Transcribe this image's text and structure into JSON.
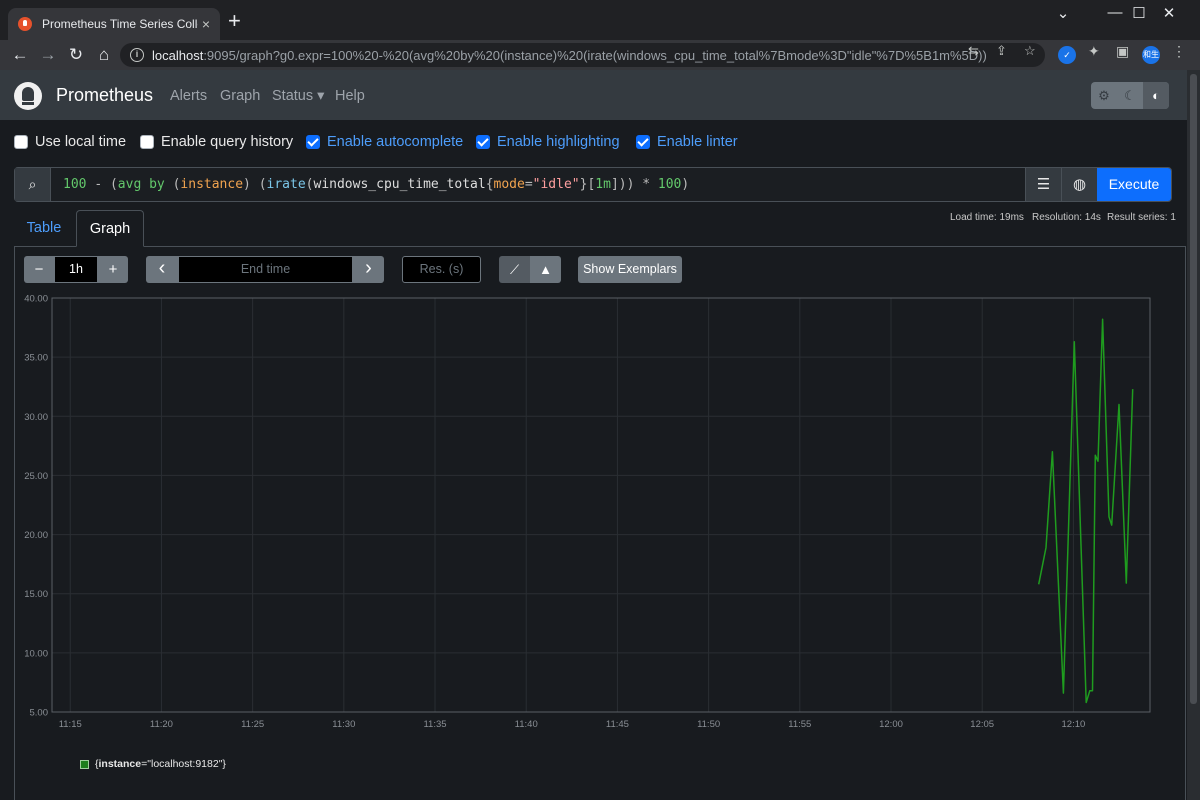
{
  "browser": {
    "tab_title": "Prometheus Time Series Collectio",
    "close_glyph": "×",
    "new_tab_glyph": "+",
    "url_host": "localhost",
    "url_rest": ":9095/graph?g0.expr=100%20-%20(avg%20by%20(instance)%20(irate(windows_cpu_time_total%7Bmode%3D\"idle\"%7D%5B1m%5D))%2...",
    "profile_label": "和生"
  },
  "nav": {
    "brand": "Prometheus",
    "links": [
      "Alerts",
      "Graph",
      "Status ▾",
      "Help"
    ]
  },
  "options": [
    {
      "label": "Use local time",
      "checked": false
    },
    {
      "label": "Enable query history",
      "checked": false
    },
    {
      "label": "Enable autocomplete",
      "checked": true
    },
    {
      "label": "Enable highlighting",
      "checked": true
    },
    {
      "label": "Enable linter",
      "checked": true
    }
  ],
  "query": {
    "expression": "100 - (avg by (instance) (irate(windows_cpu_time_total{mode=\"idle\"}[1m])) * 100)",
    "execute_label": "Execute"
  },
  "stats": {
    "load_time": "Load time: 19ms",
    "resolution": "Resolution: 14s",
    "result_series": "Result series: 1"
  },
  "tabs": {
    "table": "Table",
    "graph": "Graph"
  },
  "graph_controls": {
    "minus": "−",
    "range": "1h",
    "plus": "+",
    "prev": "‹",
    "end_time_placeholder": "End time",
    "next": "›",
    "resolution_placeholder": "Res. (s)",
    "show_exemplars": "Show Exemplars"
  },
  "chart_data": {
    "type": "line",
    "x_ticks": [
      "11:15",
      "11:20",
      "11:25",
      "11:30",
      "11:35",
      "11:40",
      "11:45",
      "11:50",
      "11:55",
      "12:00",
      "12:05",
      "12:10"
    ],
    "y_ticks": [
      "5.00",
      "10.00",
      "15.00",
      "20.00",
      "25.00",
      "30.00",
      "35.00",
      "40.00"
    ],
    "ylim": [
      5,
      40
    ],
    "xlim_minutes": [
      -1,
      59.2
    ],
    "grid": true,
    "series": [
      {
        "name": "{instance=\"localhost:9182\"}",
        "color": "#1f9c1f",
        "points": [
          [
            53.1,
            15.8
          ],
          [
            53.5,
            18.9
          ],
          [
            53.85,
            27.0
          ],
          [
            54.45,
            6.6
          ],
          [
            55.05,
            36.3
          ],
          [
            55.7,
            5.8
          ],
          [
            55.9,
            6.8
          ],
          [
            56.05,
            6.8
          ],
          [
            56.2,
            26.7
          ],
          [
            56.35,
            26.2
          ],
          [
            56.6,
            38.2
          ],
          [
            56.95,
            21.5
          ],
          [
            57.1,
            20.8
          ],
          [
            57.5,
            31.0
          ],
          [
            57.9,
            15.9
          ],
          [
            58.25,
            32.3
          ]
        ]
      }
    ]
  },
  "legend": {
    "key": "instance",
    "value": "=\"localhost:9182\"}",
    "open": "{"
  }
}
